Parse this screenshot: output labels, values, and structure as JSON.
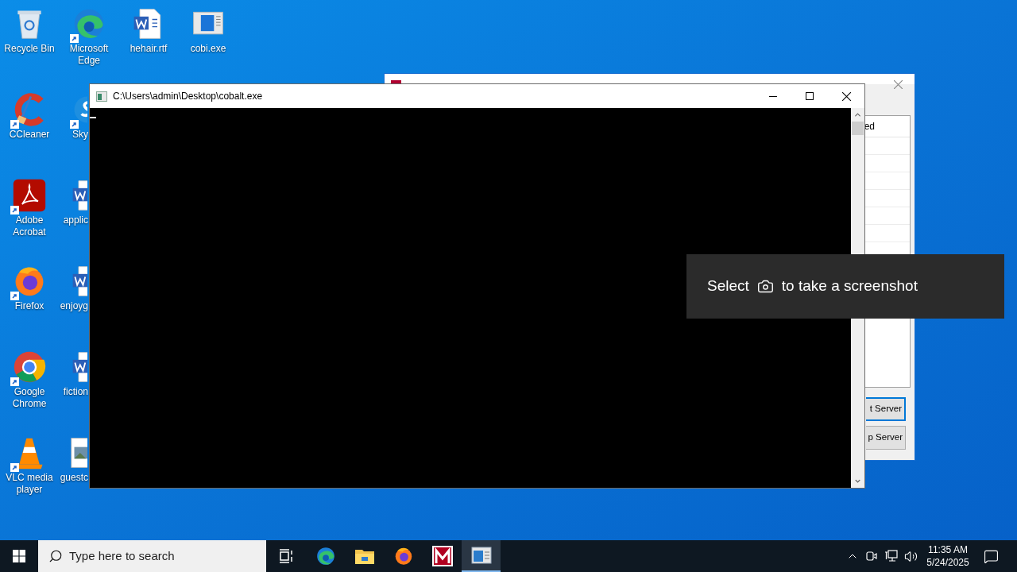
{
  "desktop_icons": [
    {
      "label": "Recycle Bin",
      "kind": "recycle",
      "shortcut": false
    },
    {
      "label": "CCleaner",
      "kind": "ccleaner",
      "shortcut": true
    },
    {
      "label": "Adobe Acrobat",
      "kind": "pdf",
      "shortcut": true
    },
    {
      "label": "Firefox",
      "kind": "firefox",
      "shortcut": true
    },
    {
      "label": "Google Chrome",
      "kind": "chrome",
      "shortcut": true
    },
    {
      "label": "VLC media player",
      "kind": "vlc",
      "shortcut": true
    },
    {
      "label": "Microsoft Edge",
      "kind": "edge",
      "shortcut": true
    },
    {
      "label": "Sky",
      "kind": "skype",
      "shortcut": true
    },
    {
      "label": "applic",
      "kind": "word",
      "shortcut": false
    },
    {
      "label": "enjoyg",
      "kind": "word",
      "shortcut": false
    },
    {
      "label": "fiction",
      "kind": "word",
      "shortcut": false
    },
    {
      "label": "guestc",
      "kind": "image",
      "shortcut": false
    },
    {
      "label": "hehair.rtf",
      "kind": "word",
      "shortcut": false
    },
    {
      "label": "cobi.exe",
      "kind": "exe",
      "shortcut": false
    }
  ],
  "background_window": {
    "list_header": "ed",
    "buttons": [
      {
        "label": "t Server",
        "focused": true
      },
      {
        "label": "p Server",
        "focused": false
      }
    ]
  },
  "console_window": {
    "title": "C:\\Users\\admin\\Desktop\\cobalt.exe"
  },
  "toast": {
    "text_before": "Select",
    "text_after": "to take a screenshot"
  },
  "taskbar": {
    "search_placeholder": "Type here to search",
    "apps": [
      {
        "kind": "taskview",
        "selected": false
      },
      {
        "kind": "edge",
        "selected": false
      },
      {
        "kind": "explorer",
        "selected": false
      },
      {
        "kind": "firefox",
        "selected": false
      },
      {
        "kind": "m-app",
        "selected": false
      },
      {
        "kind": "console",
        "selected": true
      }
    ],
    "time": "11:35 AM",
    "date": "5/24/2025"
  }
}
